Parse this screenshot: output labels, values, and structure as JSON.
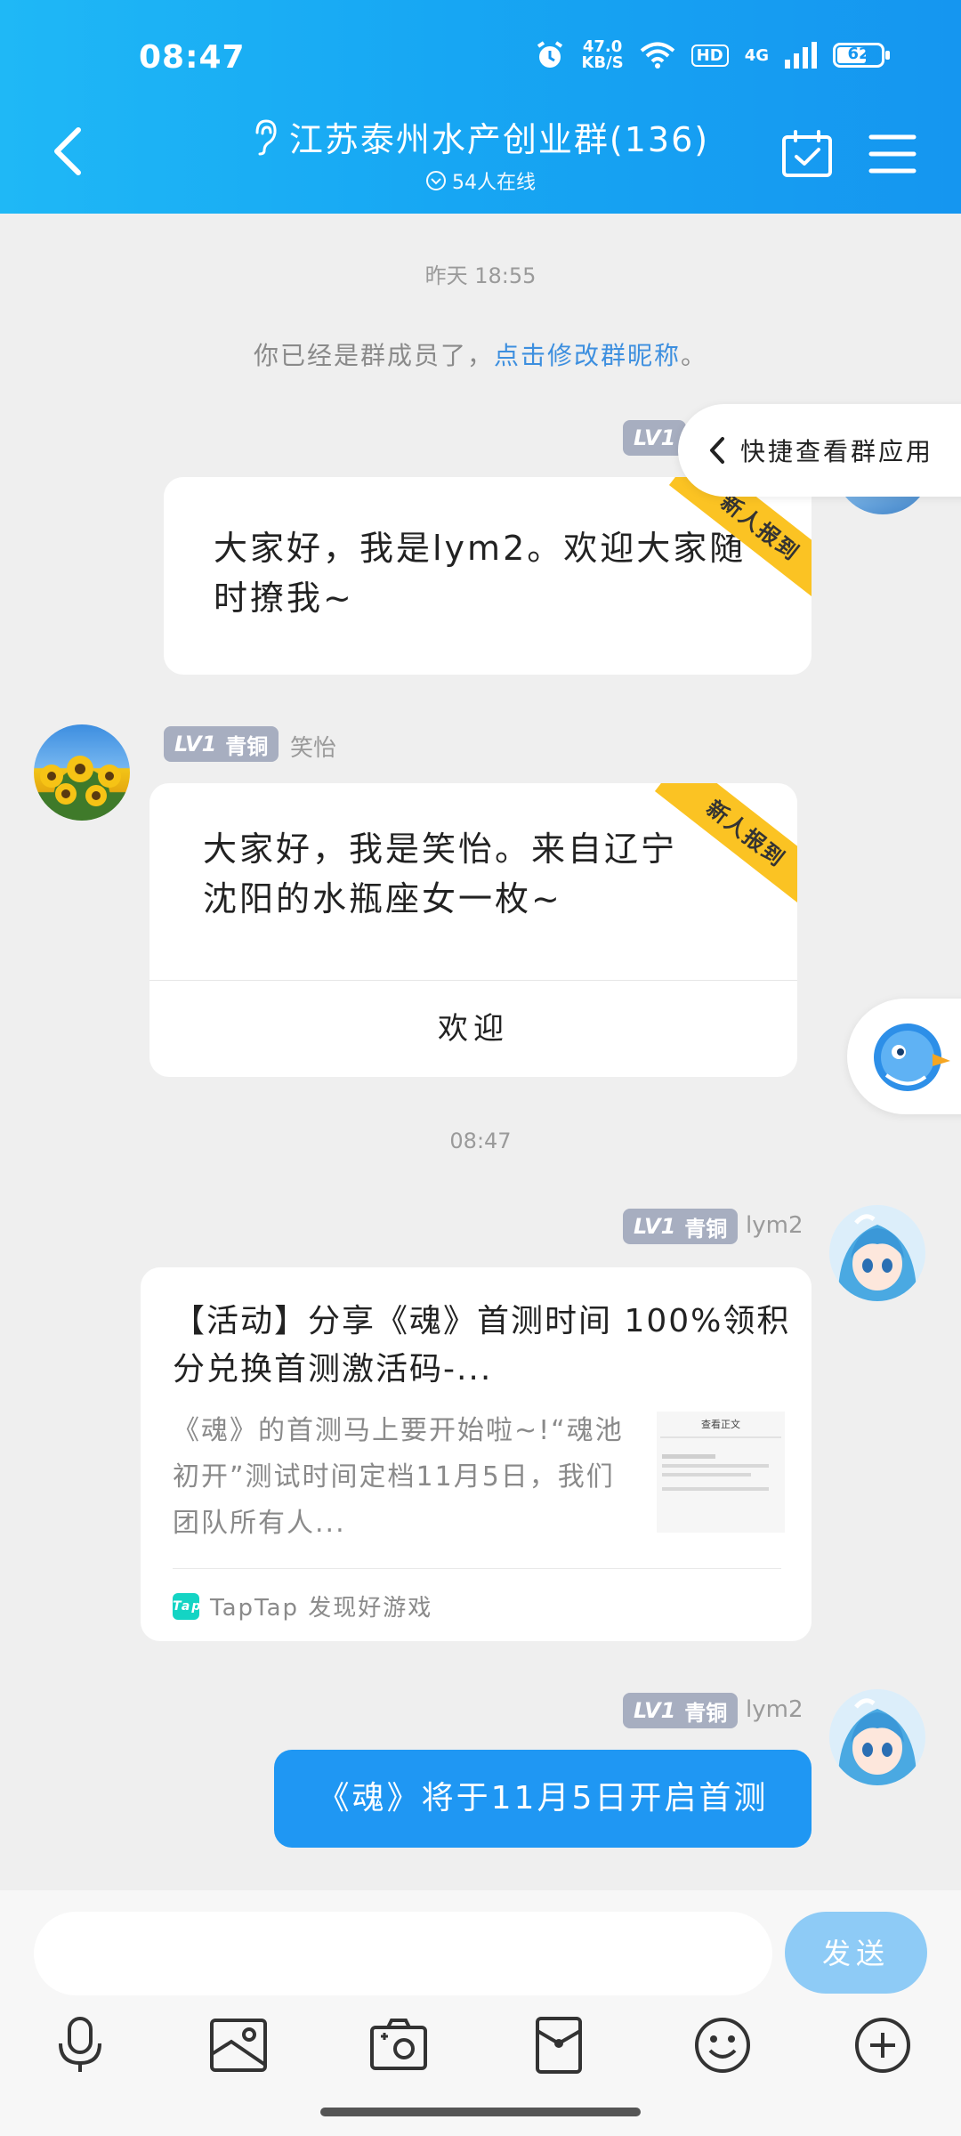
{
  "status_bar": {
    "time": "08:47",
    "net_speed_value": "47.0",
    "net_speed_unit": "KB/S",
    "hd": "HD",
    "signal": "4G",
    "battery": "62"
  },
  "header": {
    "title": "江苏泰州水产创业群(136)",
    "online": "54人在线"
  },
  "chat": {
    "time_yesterday": "昨天 18:55",
    "system_prefix": "你已经是群成员了，",
    "system_link": "点击修改群昵称",
    "system_suffix": "。",
    "msg1": {
      "level": "LV1",
      "ribbon": "新人报到",
      "text": "大家好，我是lym2。欢迎大家随时撩我~"
    },
    "msg2": {
      "level": "LV1",
      "level_name": "青铜",
      "nick": "笑怡",
      "ribbon": "新人报到",
      "text": "大家好，我是笑怡。来自辽宁沈阳的水瓶座女一枚~",
      "action": "欢迎"
    },
    "time_today": "08:47",
    "msg3": {
      "level": "LV1",
      "level_name": "青铜",
      "nick": "lym2",
      "title": "【活动】分享《魂》首测时间 100%领积分兑换首测激活码-...",
      "desc": "《魂》的首测马上要开始啦~!“魂池初开”测试时间定档11月5日，我们团队所有人...",
      "thumb_caption": "查看正文",
      "source_logo": "Tap",
      "source": "TapTap 发现好游戏"
    },
    "msg4": {
      "level": "LV1",
      "level_name": "青铜",
      "nick": "lym2",
      "text": "《魂》将于11月5日开启首测"
    }
  },
  "quick_panel": {
    "label": "快捷查看群应用"
  },
  "composer": {
    "placeholder": "",
    "send_label": "发送"
  },
  "colors": {
    "header_blue": "#1596f0",
    "link_blue": "#3d8fdf",
    "ribbon_yellow": "#fbc323",
    "badge_gray": "#a7aec0",
    "bubble_blue": "#1f97f3",
    "send_disabled": "#8ecbf6"
  }
}
